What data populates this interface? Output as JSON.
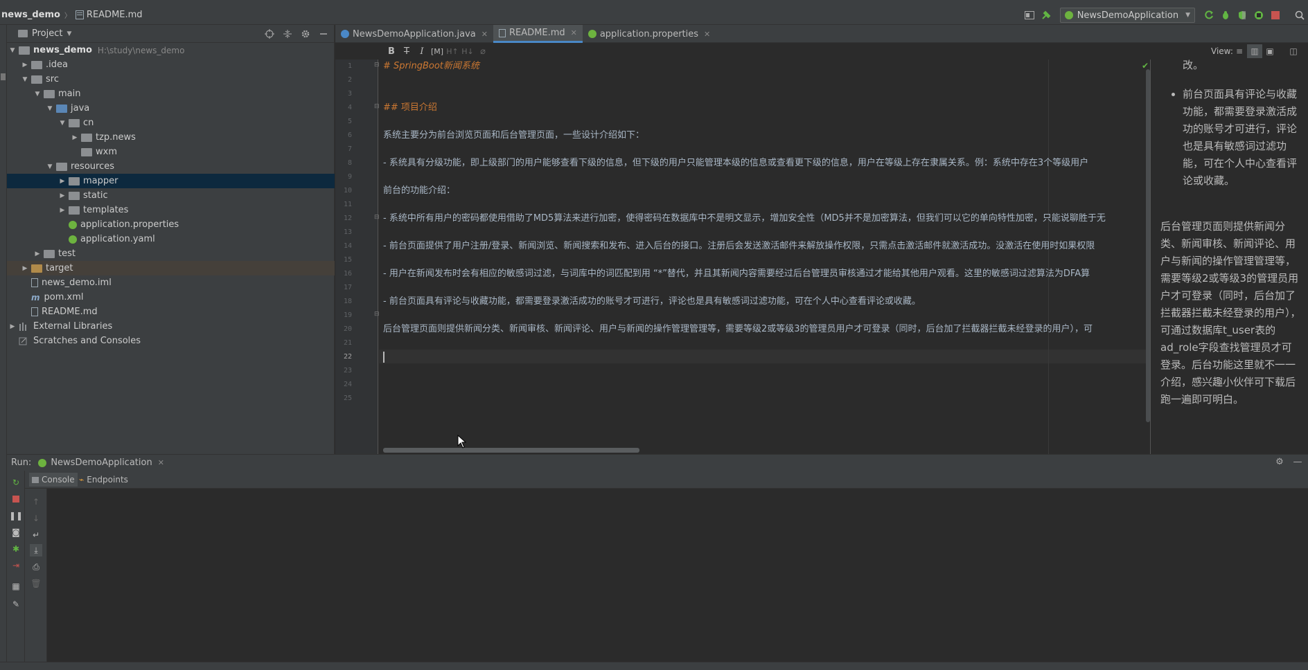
{
  "nav": {
    "project": "news_demo",
    "file": "README.md",
    "run_config": "NewsDemoApplication"
  },
  "project_panel": {
    "title": "Project",
    "tree": [
      {
        "label": "news_demo",
        "path": "H:\\study\\news_demo"
      },
      {
        "label": ".idea"
      },
      {
        "label": "src"
      },
      {
        "label": "main"
      },
      {
        "label": "java"
      },
      {
        "label": "cn"
      },
      {
        "label": "tzp.news"
      },
      {
        "label": "wxm"
      },
      {
        "label": "resources"
      },
      {
        "label": "mapper"
      },
      {
        "label": "static"
      },
      {
        "label": "templates"
      },
      {
        "label": "application.properties"
      },
      {
        "label": "application.yaml"
      },
      {
        "label": "test"
      },
      {
        "label": "target"
      },
      {
        "label": "news_demo.iml"
      },
      {
        "label": "pom.xml"
      },
      {
        "label": "README.md"
      },
      {
        "label": "External Libraries"
      },
      {
        "label": "Scratches and Consoles"
      }
    ]
  },
  "tabs": [
    {
      "label": "NewsDemoApplication.java"
    },
    {
      "label": "README.md"
    },
    {
      "label": "application.properties"
    }
  ],
  "md_toolbar": {
    "view_label": "View:"
  },
  "editor": {
    "line_numbers": [
      "1",
      "2",
      "3",
      "4",
      "5",
      "6",
      "7",
      "8",
      "9",
      "10",
      "11",
      "12",
      "13",
      "14",
      "15",
      "16",
      "17",
      "18",
      "19",
      "20",
      "21",
      "22",
      "23",
      "24",
      "25"
    ],
    "lines": {
      "l1_mark": "# ",
      "l1_text": "SpringBoot新闻系统",
      "l4_mark": "## ",
      "l4_text": "项目介绍",
      "l6": "系统主要分为前台浏览页面和后台管理页面，一些设计介绍如下：",
      "l8": "- 系统具有分级功能，即上级部门的用户能够查看下级的信息，但下级的用户只能管理本级的信息或查看更下级的信息，用户在等级上存在隶属关系。例：系统中存在3个等级用户",
      "l10": "前台的功能介绍：",
      "l12": "- 系统中所有用户的密码都使用借助了MD5算法来进行加密，使得密码在数据库中不是明文显示，增加安全性（MD5并不是加密算法，但我们可以它的单向特性加密，只能说聊胜于无",
      "l14": "- 前台页面提供了用户注册/登录、新闻浏览、新闻搜索和发布、进入后台的接口。注册后会发送激活邮件来解放操作权限，只需点击激活邮件就激活成功。没激活在使用时如果权限",
      "l16": "- 用户在新闻发布时会有相应的敏感词过滤，与词库中的词匹配到用 “*”替代，并且其新闻内容需要经过后台管理员审核通过才能给其他用户观看。这里的敏感词过滤算法为DFA算",
      "l18": "- 前台页面具有评论与收藏功能，都需要登录激活成功的账号才可进行，评论也是具有敏感词过滤功能，可在个人中心查看评论或收藏。",
      "l20": "后台管理页面则提供新闻分类、新闻审核、新闻评论、用户与新闻的操作管理管理等，需要等级2或等级3的管理员用户才可登录（同时，后台加了拦截器拦截未经登录的用户），可"
    }
  },
  "preview": {
    "top_fragment": "改。",
    "bullet": "前台页面具有评论与收藏功能，都需要登录激活成功的账号才可进行，评论也是具有敏感词过滤功能，可在个人中心查看评论或收藏。",
    "para": "后台管理页面则提供新闻分类、新闻审核、新闻评论、用户与新闻的操作管理管理等，需要等级2或等级3的管理员用户才可登录（同时，后台加了拦截器拦截未经登录的用户），可通过数据库t_user表的ad_role字段查找管理员才可登录。后台功能这里就不一一介绍，感兴趣小伙伴可下载后跑一遍即可明白。"
  },
  "run_panel": {
    "label": "Run:",
    "tab": "NewsDemoApplication",
    "console_tab": "Console",
    "endpoints_tab": "Endpoints"
  },
  "colors": {
    "bg": "#2b2b2b",
    "panel": "#3c3f41",
    "selection": "#0d293e",
    "accent": "#4a88c7",
    "run_green": "#62b543",
    "stop_red": "#c75450",
    "spring_green": "#6db33f"
  }
}
